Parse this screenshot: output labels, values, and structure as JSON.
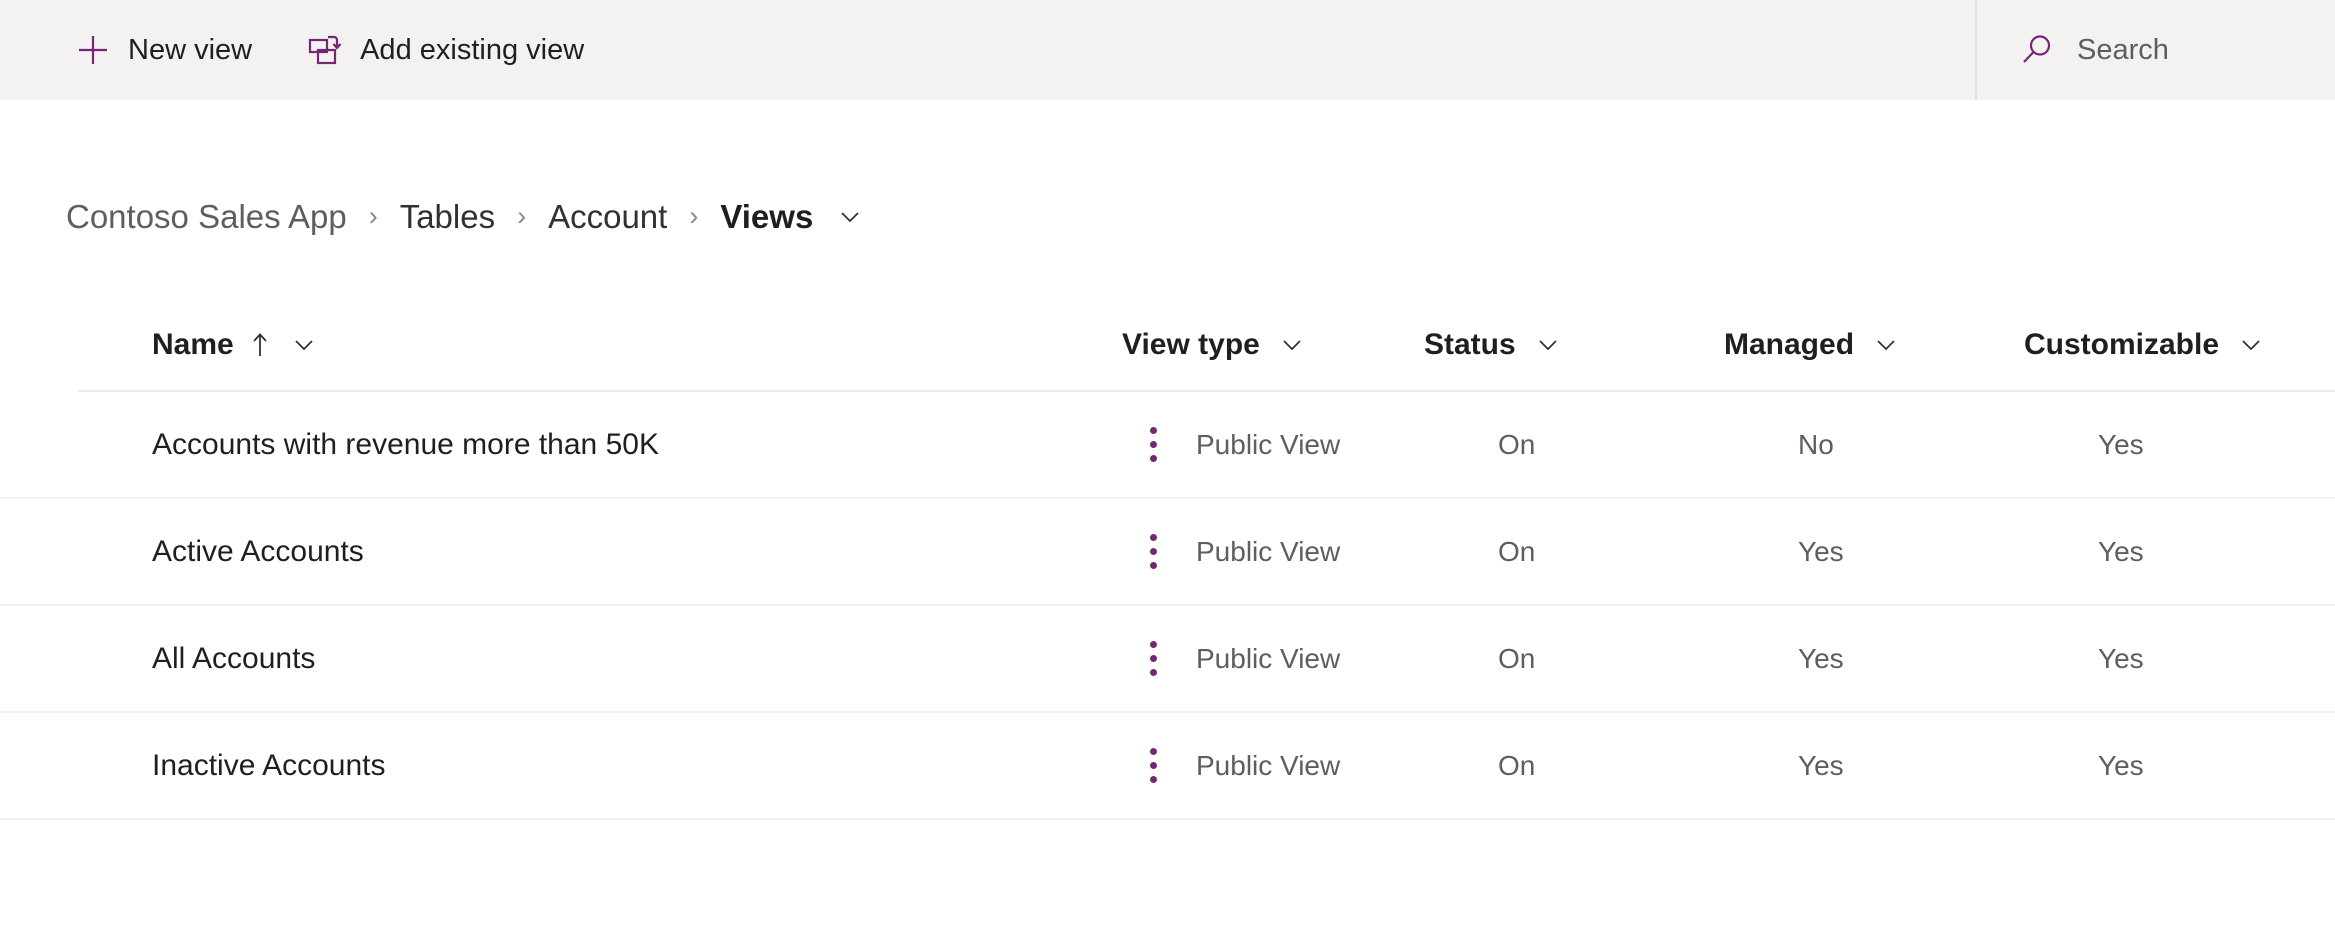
{
  "command_bar": {
    "buttons": [
      {
        "label": "New view",
        "icon": "plus-icon"
      },
      {
        "label": "Add existing view",
        "icon": "add-existing-view-icon"
      }
    ],
    "search": {
      "placeholder": "Search",
      "icon": "search-icon"
    }
  },
  "breadcrumb": {
    "items": [
      {
        "label": "Contoso Sales App",
        "current": false
      },
      {
        "label": "Tables",
        "current": false
      },
      {
        "label": "Account",
        "current": false
      },
      {
        "label": "Views",
        "current": true
      }
    ],
    "separator": "›",
    "chevron_icon": "chevron-down-icon"
  },
  "grid": {
    "columns": [
      {
        "label": "Name",
        "sorted": "ascending",
        "sort_icon": "arrow-up-icon",
        "menu_icon": "chevron-down-icon"
      },
      {
        "label": "View type",
        "sorted": "none",
        "menu_icon": "chevron-down-icon"
      },
      {
        "label": "Status",
        "sorted": "none",
        "menu_icon": "chevron-down-icon"
      },
      {
        "label": "Managed",
        "sorted": "none",
        "menu_icon": "chevron-down-icon"
      },
      {
        "label": "Customizable",
        "sorted": "none",
        "menu_icon": "chevron-down-icon"
      }
    ],
    "row_menu_icon": "more-vertical-icon",
    "rows": [
      {
        "name": "Accounts with revenue more than 50K",
        "view_type": "Public View",
        "status": "On",
        "managed": "No",
        "customizable": "Yes"
      },
      {
        "name": "Active Accounts",
        "view_type": "Public View",
        "status": "On",
        "managed": "Yes",
        "customizable": "Yes"
      },
      {
        "name": "All Accounts",
        "view_type": "Public View",
        "status": "On",
        "managed": "Yes",
        "customizable": "Yes"
      },
      {
        "name": "Inactive Accounts",
        "view_type": "Public View",
        "status": "On",
        "managed": "Yes",
        "customizable": "Yes"
      }
    ]
  },
  "colors": {
    "accent_purple": "#742774",
    "command_bar_bg": "#f3f2f1",
    "text_primary": "#201f1e",
    "text_secondary": "#605e5c",
    "divider": "#edebe9"
  }
}
